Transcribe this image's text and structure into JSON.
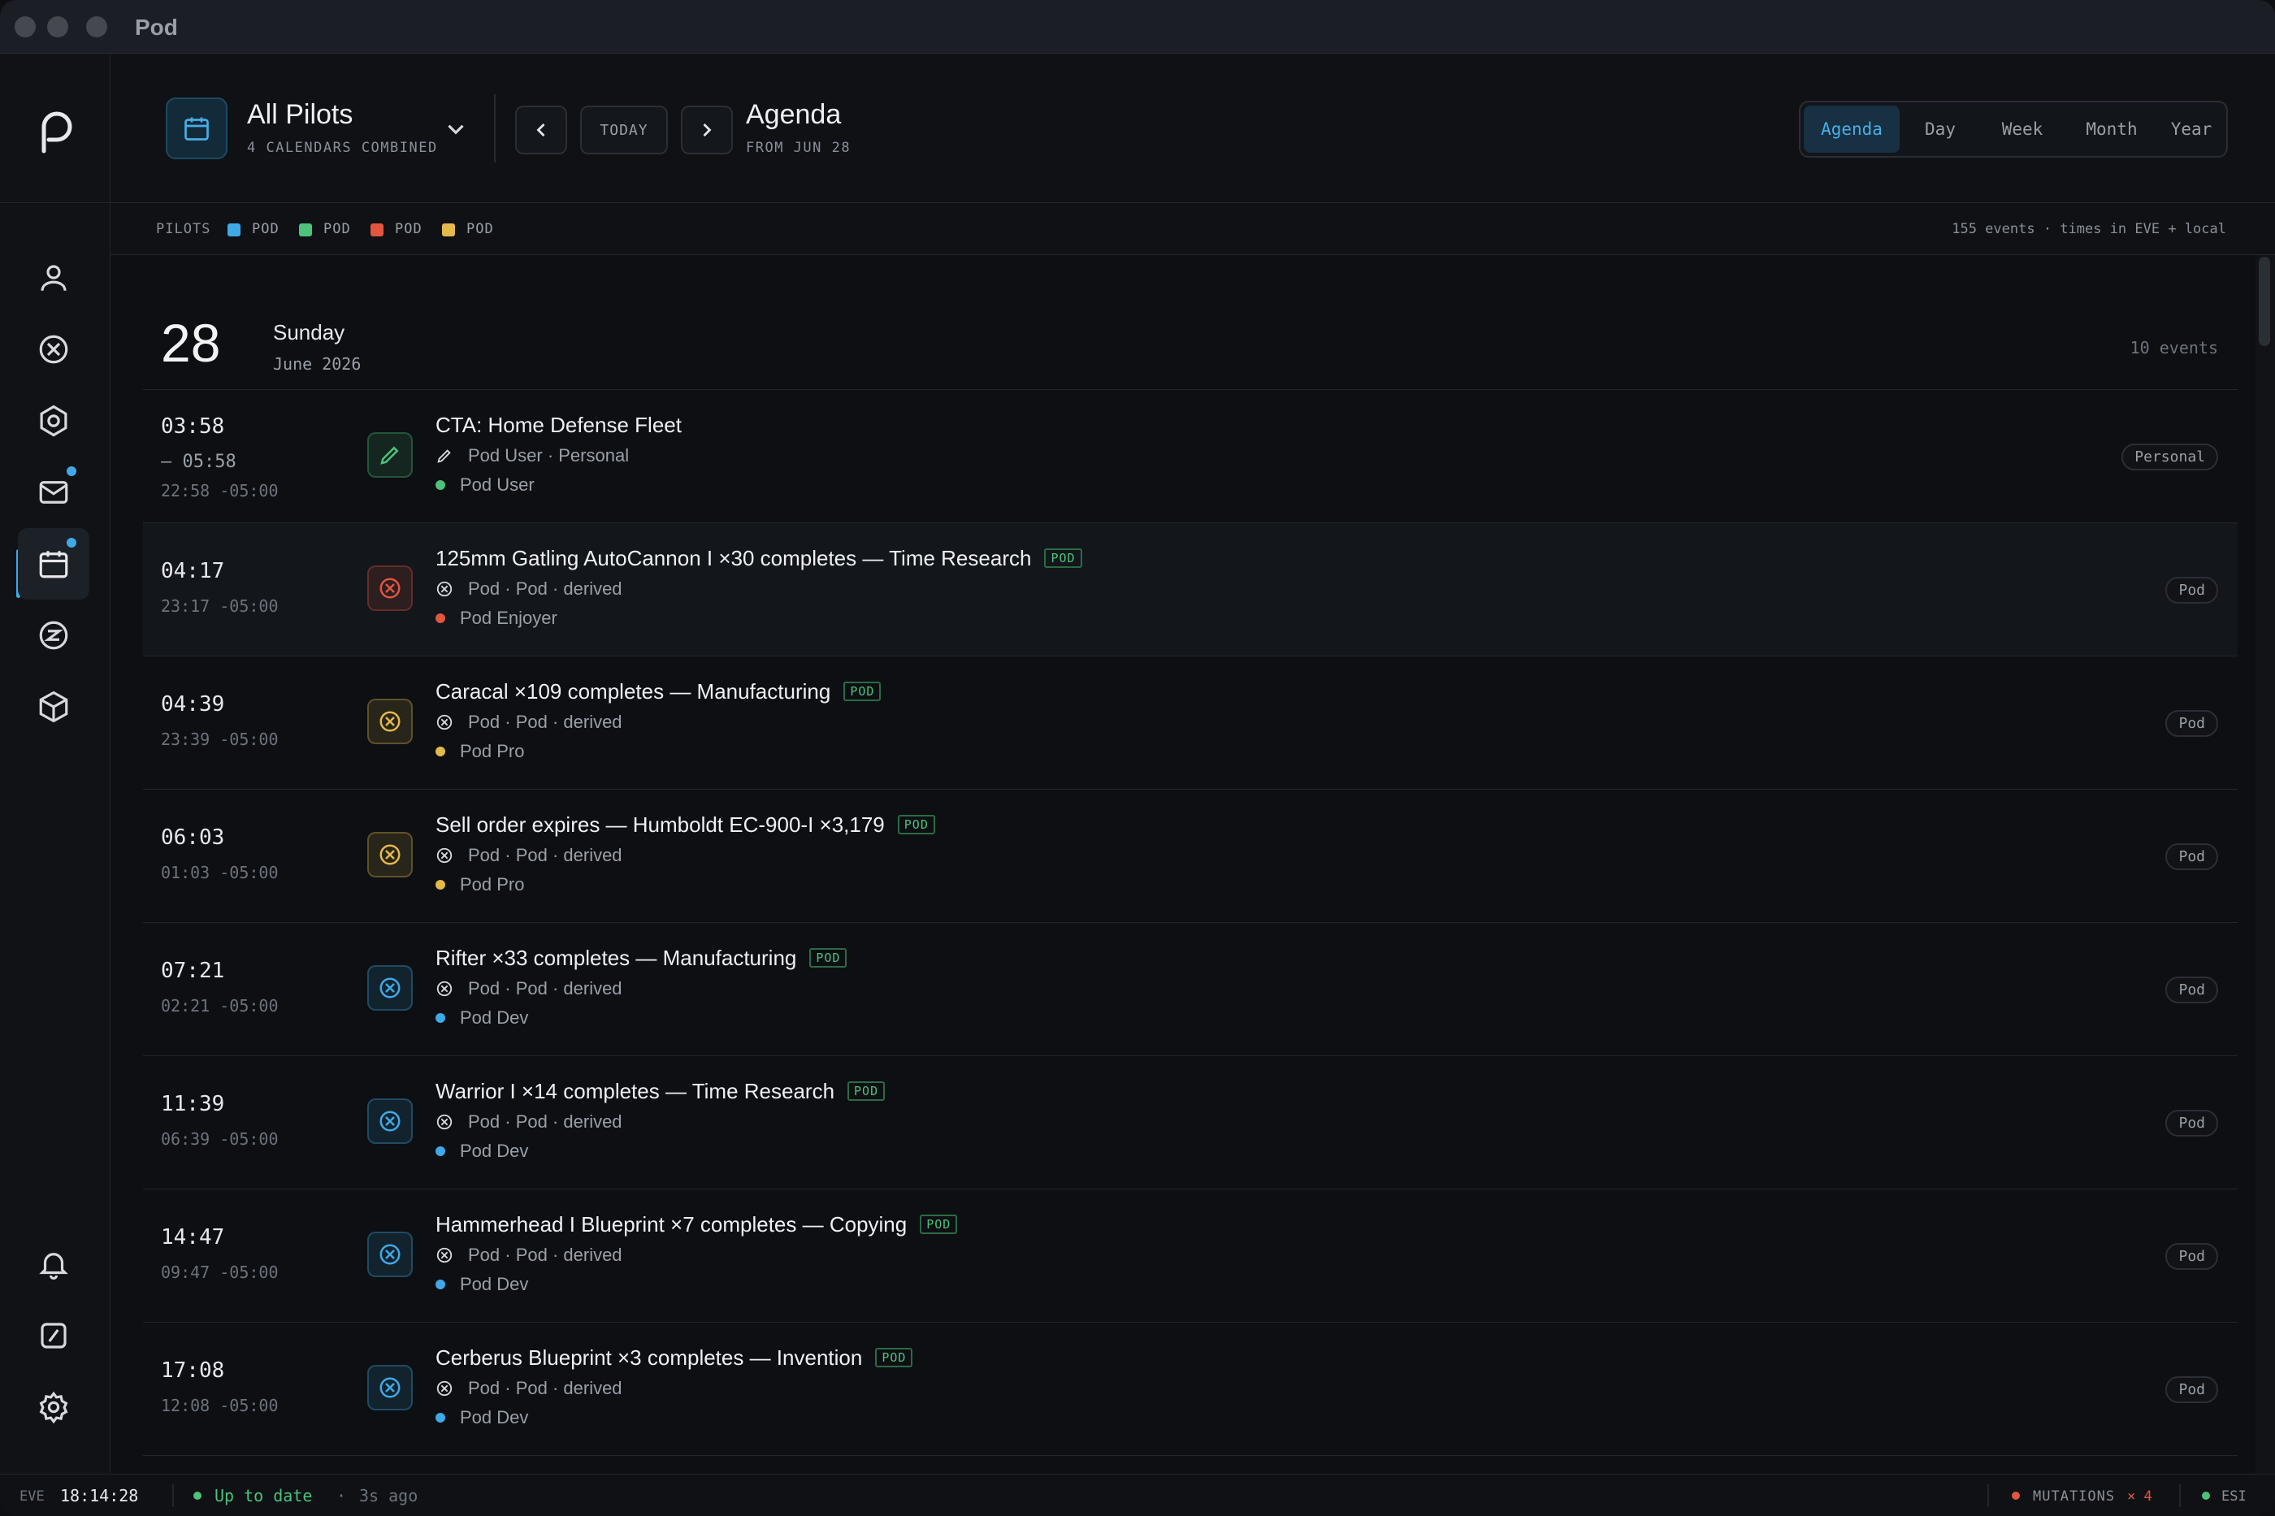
{
  "window": {
    "title": "Pod"
  },
  "header": {
    "calendar_title": "All Pilots",
    "calendar_subtitle": "4 CALENDARS COMBINED",
    "today_label": "TODAY",
    "view_title": "Agenda",
    "view_subtitle": "FROM JUN 28",
    "view_tabs": [
      {
        "label": "Agenda",
        "active": true
      },
      {
        "label": "Day",
        "active": false
      },
      {
        "label": "Week",
        "active": false
      },
      {
        "label": "Month",
        "active": false
      },
      {
        "label": "Year",
        "active": false
      }
    ]
  },
  "filter": {
    "label": "PILOTS",
    "pilots": [
      {
        "label": "POD",
        "color": "#3fa9e8"
      },
      {
        "label": "POD",
        "color": "#4cc27a"
      },
      {
        "label": "POD",
        "color": "#e2553f"
      },
      {
        "label": "POD",
        "color": "#e3b94a"
      }
    ],
    "summary": "155 events · times in EVE + local"
  },
  "day": {
    "number": "28",
    "weekday": "Sunday",
    "month_year": "June 2026",
    "count": "10 events"
  },
  "events": [
    {
      "time": "03:58",
      "end": "– 05:58",
      "local": "22:58 -05:00",
      "title": "CTA: Home Defense Fleet",
      "tag": "",
      "source": "Pod User · Personal",
      "source_icon": "pencil-icon",
      "pilot": "Pod User",
      "pilot_color": "#4cc27a",
      "badge": "Personal",
      "icon": "pencil-icon",
      "color": "#4cc27a",
      "highlight": false
    },
    {
      "time": "04:17",
      "end": "",
      "local": "23:17 -05:00",
      "title": "125mm Gatling AutoCannon I ×30 completes — Time Research",
      "tag": "POD",
      "source": "Pod · Pod · derived",
      "source_icon": "industry-icon",
      "pilot": "Pod Enjoyer",
      "pilot_color": "#e2553f",
      "badge": "Pod",
      "icon": "industry-icon",
      "color": "#e2553f",
      "highlight": true
    },
    {
      "time": "04:39",
      "end": "",
      "local": "23:39 -05:00",
      "title": "Caracal ×109 completes — Manufacturing",
      "tag": "POD",
      "source": "Pod · Pod · derived",
      "source_icon": "industry-icon",
      "pilot": "Pod Pro",
      "pilot_color": "#e3b94a",
      "badge": "Pod",
      "icon": "industry-icon",
      "color": "#e3b94a",
      "highlight": false
    },
    {
      "time": "06:03",
      "end": "",
      "local": "01:03 -05:00",
      "title": "Sell order expires — Humboldt EC-900-I ×3,179",
      "tag": "POD",
      "source": "Pod · Pod · derived",
      "source_icon": "industry-icon",
      "pilot": "Pod Pro",
      "pilot_color": "#e3b94a",
      "badge": "Pod",
      "icon": "industry-icon",
      "color": "#e3b94a",
      "highlight": false
    },
    {
      "time": "07:21",
      "end": "",
      "local": "02:21 -05:00",
      "title": "Rifter ×33 completes — Manufacturing",
      "tag": "POD",
      "source": "Pod · Pod · derived",
      "source_icon": "industry-icon",
      "pilot": "Pod Dev",
      "pilot_color": "#3fa9e8",
      "badge": "Pod",
      "icon": "industry-icon",
      "color": "#3fa9e8",
      "highlight": false
    },
    {
      "time": "11:39",
      "end": "",
      "local": "06:39 -05:00",
      "title": "Warrior I ×14 completes — Time Research",
      "tag": "POD",
      "source": "Pod · Pod · derived",
      "source_icon": "industry-icon",
      "pilot": "Pod Dev",
      "pilot_color": "#3fa9e8",
      "badge": "Pod",
      "icon": "industry-icon",
      "color": "#3fa9e8",
      "highlight": false
    },
    {
      "time": "14:47",
      "end": "",
      "local": "09:47 -05:00",
      "title": "Hammerhead I Blueprint ×7 completes — Copying",
      "tag": "POD",
      "source": "Pod · Pod · derived",
      "source_icon": "industry-icon",
      "pilot": "Pod Dev",
      "pilot_color": "#3fa9e8",
      "badge": "Pod",
      "icon": "industry-icon",
      "color": "#3fa9e8",
      "highlight": false
    },
    {
      "time": "17:08",
      "end": "",
      "local": "12:08 -05:00",
      "title": "Cerberus Blueprint ×3 completes — Invention",
      "tag": "POD",
      "source": "Pod · Pod · derived",
      "source_icon": "industry-icon",
      "pilot": "Pod Dev",
      "pilot_color": "#3fa9e8",
      "badge": "Pod",
      "icon": "industry-icon",
      "color": "#3fa9e8",
      "highlight": false
    }
  ],
  "statusbar": {
    "clock_label": "EVE",
    "clock": "18:14:28",
    "sync_status": "Up to date",
    "sync_sep": "·",
    "sync_ago": "3s ago",
    "mutations_label": "MUTATIONS",
    "mutations_count": "× 4",
    "esi_label": "ESI"
  },
  "colors": {
    "accent": "#3fa9e8",
    "ok": "#4cc27a",
    "error": "#e2553f",
    "warn": "#e3b94a"
  }
}
